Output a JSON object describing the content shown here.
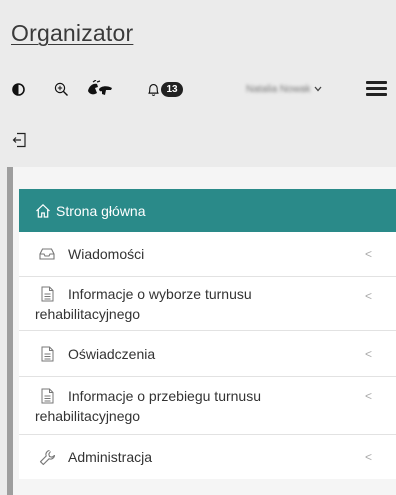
{
  "brand": "Organizator",
  "toolbar": {
    "contrast_icon": "contrast-icon",
    "zoom_icon": "zoom-in-icon",
    "sign_icon": "sign-language-icon",
    "bell_icon": "bell-icon",
    "notifications_count": "13",
    "user_name": "Natalia Nowak",
    "menu_icon": "hamburger-menu-icon",
    "logout_icon": "logout-icon"
  },
  "menu": {
    "items": [
      {
        "label": "Strona główna",
        "icon": "home-icon",
        "active": true
      },
      {
        "label": "Wiadomości",
        "icon": "inbox-icon"
      },
      {
        "label": "Informacje o wyborze turnusu",
        "label2": "rehabilitacyjnego",
        "icon": "document-icon"
      },
      {
        "label": "Oświadczenia",
        "icon": "document-icon"
      },
      {
        "label": "Informacje o przebiegu turnusu",
        "label2": "rehabilitacyjnego",
        "icon": "document-icon"
      },
      {
        "label": "Administracja",
        "icon": "wrench-icon"
      }
    ],
    "arrow": "<"
  },
  "colors": {
    "active": "#2a8a89",
    "sidebar_bar": "#9e9e9e",
    "background": "#ebebeb"
  }
}
